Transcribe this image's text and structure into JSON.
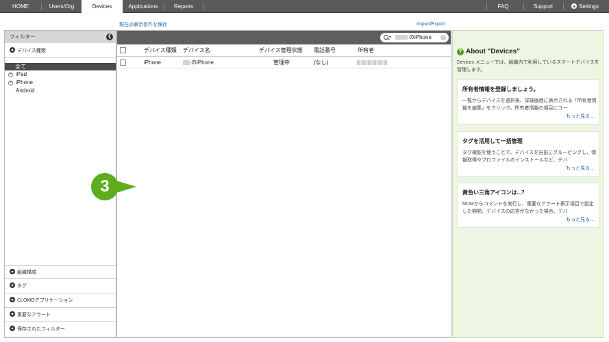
{
  "nav": {
    "tabs": [
      {
        "label": "HOME"
      },
      {
        "label": "Users/Org"
      },
      {
        "label": "Devices",
        "active": true
      },
      {
        "label": "Applications"
      },
      {
        "label": "Reports"
      }
    ],
    "right": {
      "faq": "FAQ",
      "support": "Support",
      "settings": "Settings"
    }
  },
  "links": {
    "save_view": "現在の表示条件を保存",
    "import_export": "Import/Export"
  },
  "sidebar": {
    "header": "フィルター",
    "collapse_glyph": "❮",
    "device_type_section": "デバイス種類",
    "types": [
      {
        "label": "全て",
        "selected": true
      },
      {
        "label": "iPad",
        "expandable": true
      },
      {
        "label": "iPhone",
        "expandable": true
      },
      {
        "label": "Android",
        "expandable": false
      }
    ],
    "sections": [
      {
        "label": "組織構成"
      },
      {
        "label": "タグ"
      },
      {
        "label": "CLOMOアプリケーション"
      },
      {
        "label": "重要なアラート"
      },
      {
        "label": "保存されたフィルター"
      }
    ]
  },
  "search": {
    "value": "のiPhone",
    "clear_glyph": "×",
    "caret_glyph": "▾"
  },
  "table": {
    "columns": [
      "デバイス種類",
      "デバイス名",
      "デバイス管理状態",
      "電話番号",
      "所有者"
    ],
    "rows": [
      {
        "type": "iPhone",
        "name": "のiPhone",
        "status": "管理中",
        "phone": "(なし)"
      }
    ]
  },
  "step_badge": "3",
  "help": {
    "title": "About \"Devices\"",
    "icon_glyph": "?",
    "intro": "Devices メニューでは、組織内で利用しているスマートデバイスを管理します。",
    "cards": [
      {
        "title": "所有者情報を登録しましょう。",
        "text": "一覧からデバイスを選択後、詳細画面に表示される「所有者情報を編集」をクリック。所有者情報の項目にユー",
        "more": "もっと見る..."
      },
      {
        "title": "タグを活用して一括管理",
        "text": "タグ機能を使うことで、デバイスを自由にグルーピングし、情報取得やプロファイルのインストールなど、デバ",
        "more": "もっと見る..."
      },
      {
        "title": "黄色い三角アイコンは...？",
        "text": "MDMからコマンドを実行し、重要なアラート表示項目で設定した期間、デバイスの応答がなかった場合、デバ",
        "more": "もっと見る..."
      }
    ]
  },
  "colors": {
    "nav_bg": "#5a5a5a",
    "accent_green": "#5cae1c",
    "help_bg": "#edf5e3",
    "link_blue": "#1a5fa8"
  }
}
